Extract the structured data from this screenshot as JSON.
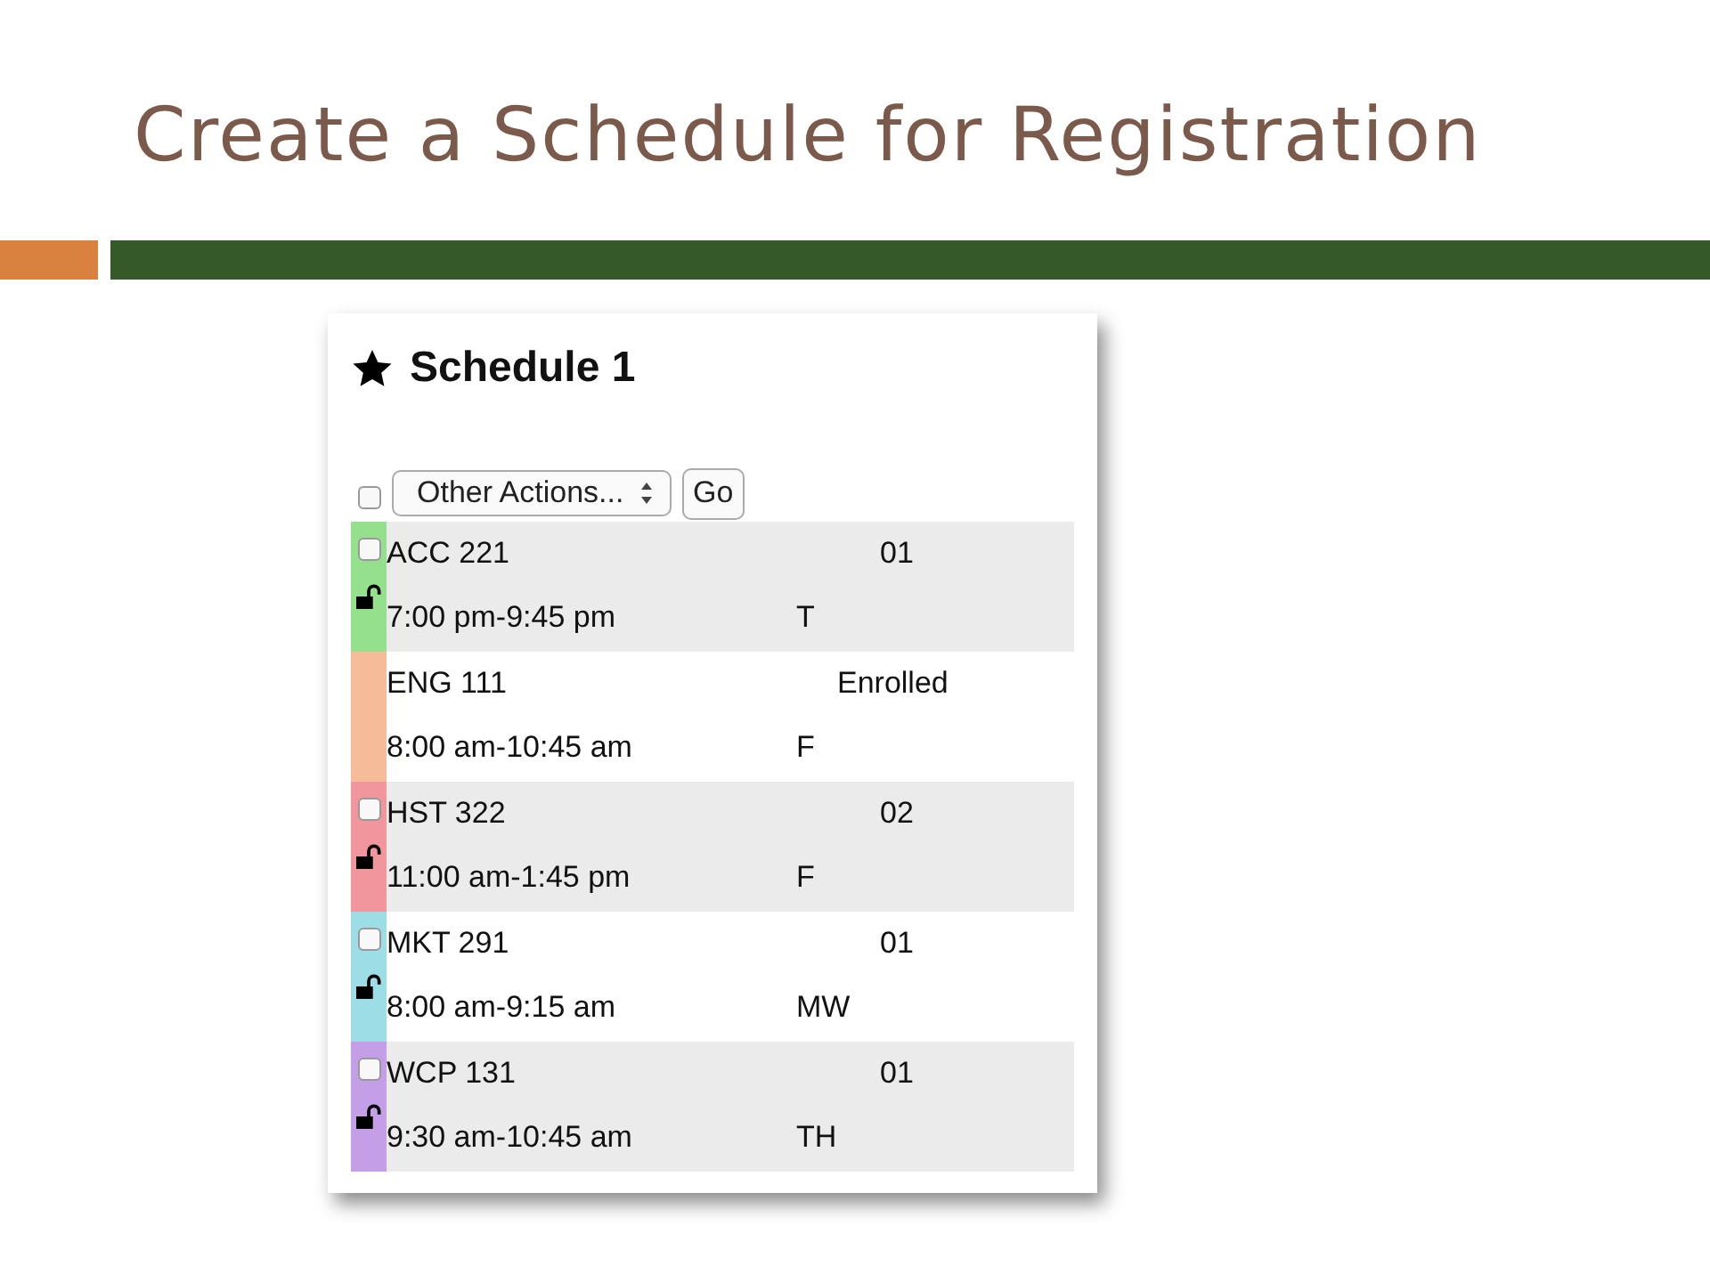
{
  "slide_title": "Create a Schedule for Registration",
  "schedule": {
    "title": "Schedule 1",
    "select_all": {
      "checked": false
    },
    "actions": {
      "value": "Other Actions..."
    },
    "go_button": "Go",
    "courses": [
      {
        "kind": "section",
        "code": "ACC 221",
        "status": "01",
        "time": "7:00 pm-9:45 pm",
        "days": "T",
        "color": "#94e08c",
        "checked": false,
        "locked": false
      },
      {
        "kind": "enrolled",
        "code": "ENG 111",
        "status": "Enrolled",
        "time": "8:00 am-10:45 am",
        "days": "F",
        "color": "#f6bc9a"
      },
      {
        "kind": "section",
        "code": "HST 322",
        "status": "02",
        "time": "11:00 am-1:45 pm",
        "days": "F",
        "color": "#f0969c",
        "checked": false,
        "locked": false
      },
      {
        "kind": "section",
        "code": "MKT 291",
        "status": "01",
        "time": "8:00 am-9:15 am",
        "days": "MW",
        "color": "#9cdde6",
        "checked": false,
        "locked": false
      },
      {
        "kind": "section",
        "code": "WCP 131",
        "status": "01",
        "time": "9:30 am-10:45 am",
        "days": "TH",
        "color": "#c49ee6",
        "checked": false,
        "locked": false
      }
    ]
  }
}
